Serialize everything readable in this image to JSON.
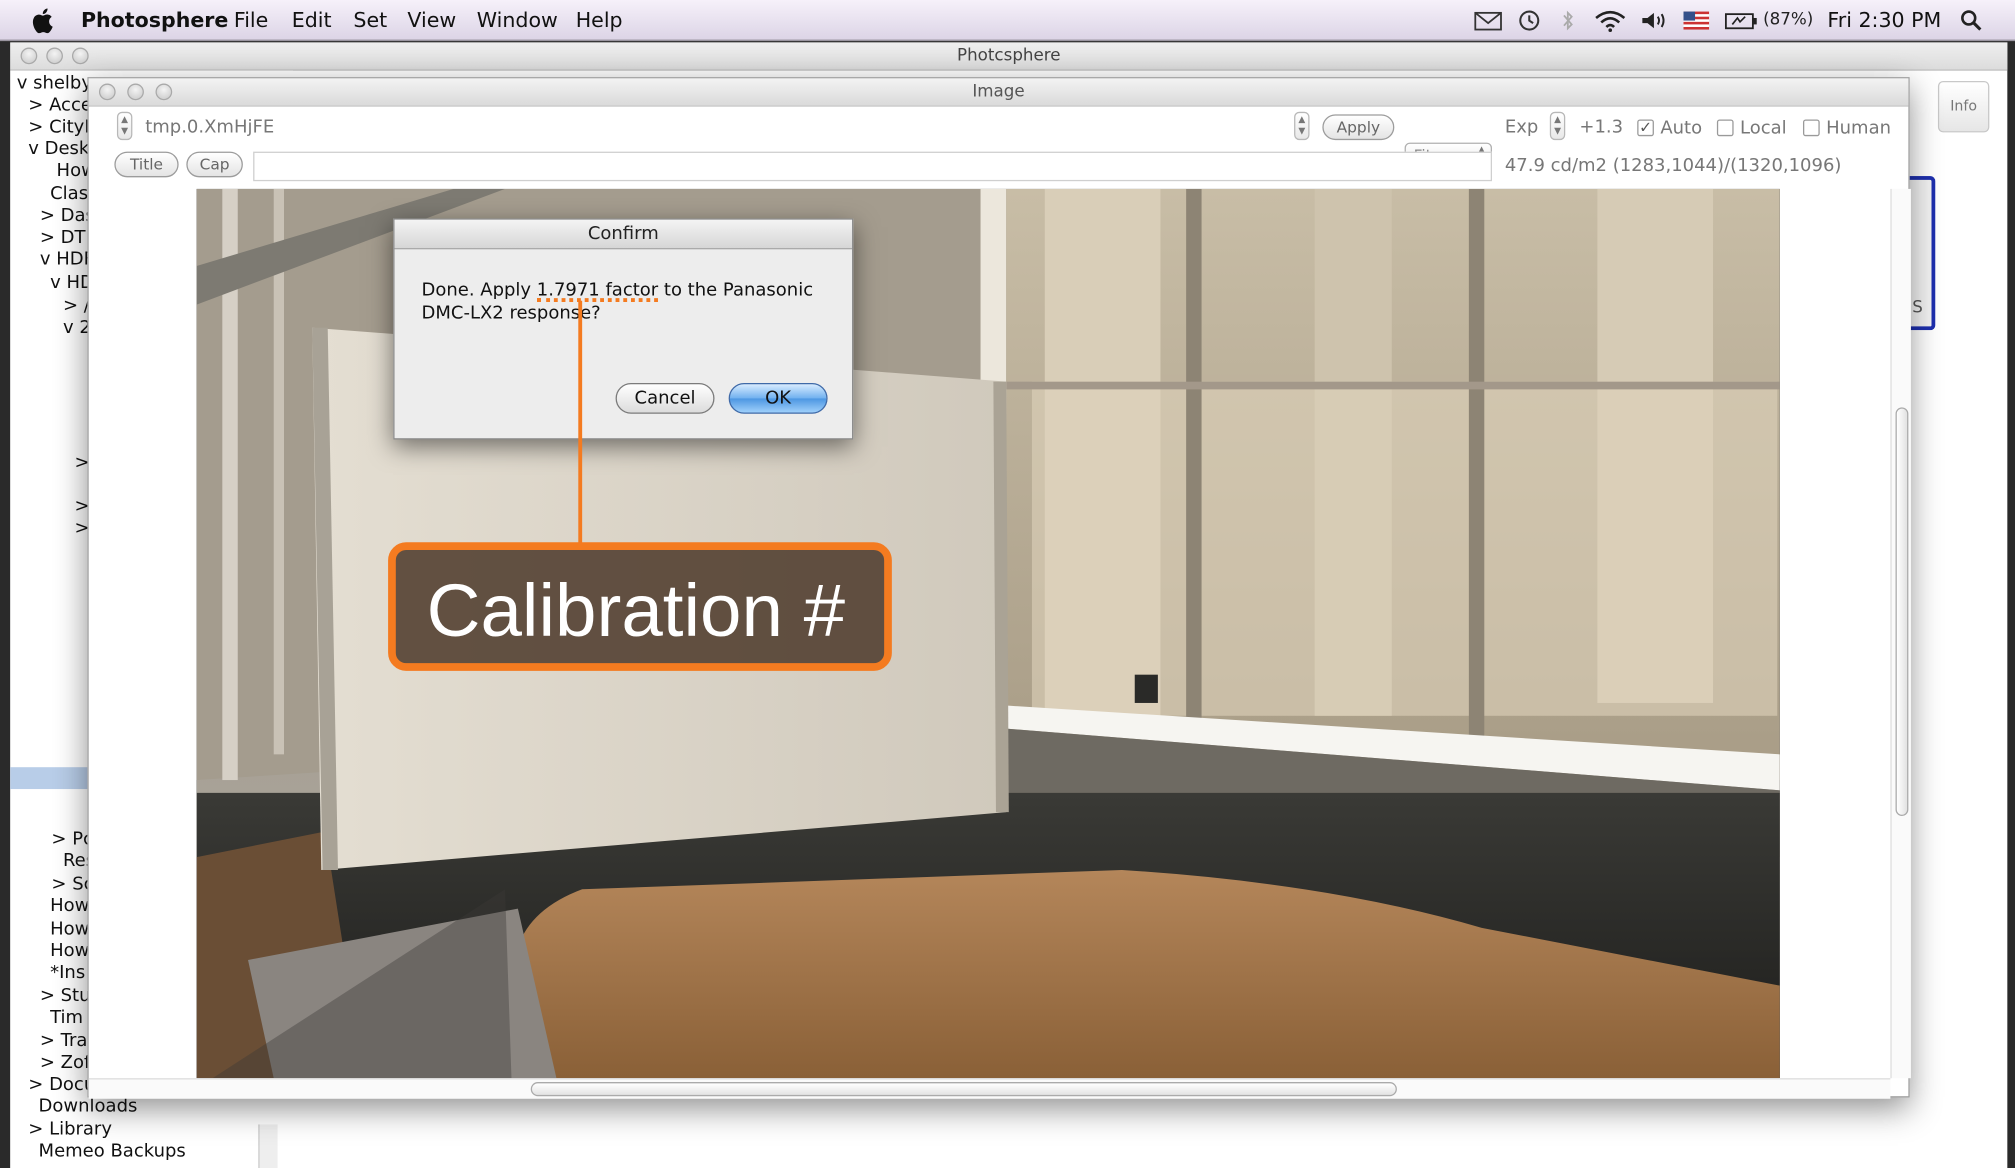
{
  "menubar": {
    "app_name": "Photosphere",
    "menus": [
      "File",
      "Edit",
      "Set",
      "View",
      "Window",
      "Help"
    ],
    "battery": "(87%)",
    "clock": "Fri 2:30 PM"
  },
  "back_window": {
    "title": "Photcsphere",
    "info_label": "Info",
    "blue_fragment_text": "S",
    "sidebar": [
      "v shelby",
      "> Acce",
      "> CityE",
      "v Desk",
      "How",
      "Clas",
      "> Das",
      "> DT",
      "v HDF",
      "v HD",
      "> /",
      "v 2",
      ">",
      ">",
      ">",
      "> Pc",
      "Res",
      "> Sc",
      "How",
      "How",
      "How",
      "*Ins",
      "> Stu",
      "Tim",
      "> Tra",
      "> Zof",
      "> Docu",
      "Downloads",
      "> Library",
      "Memeo Backups"
    ]
  },
  "image_window": {
    "title": "Image",
    "filename": "tmp.0.XmHjFE",
    "apply_label": "Apply",
    "fit_value": "Fit",
    "exp_label": "Exp",
    "exp_value": "+1.3",
    "auto_label": "Auto",
    "auto_checked": true,
    "local_label": "Local",
    "local_checked": false,
    "human_label": "Human",
    "human_checked": false,
    "title_button": "Title",
    "cap_button": "Cap",
    "caption_value": "",
    "readout": "47.9 cd/m2 (1283,1044)/(1320,1096)"
  },
  "dialog": {
    "title": "Confirm",
    "message": "Done.  Apply 1.7971 factor to the Panasonic DMC-LX2 response?",
    "cancel_label": "Cancel",
    "ok_label": "OK"
  },
  "annotation": {
    "text": "Calibration #",
    "color": "#f47b20"
  }
}
